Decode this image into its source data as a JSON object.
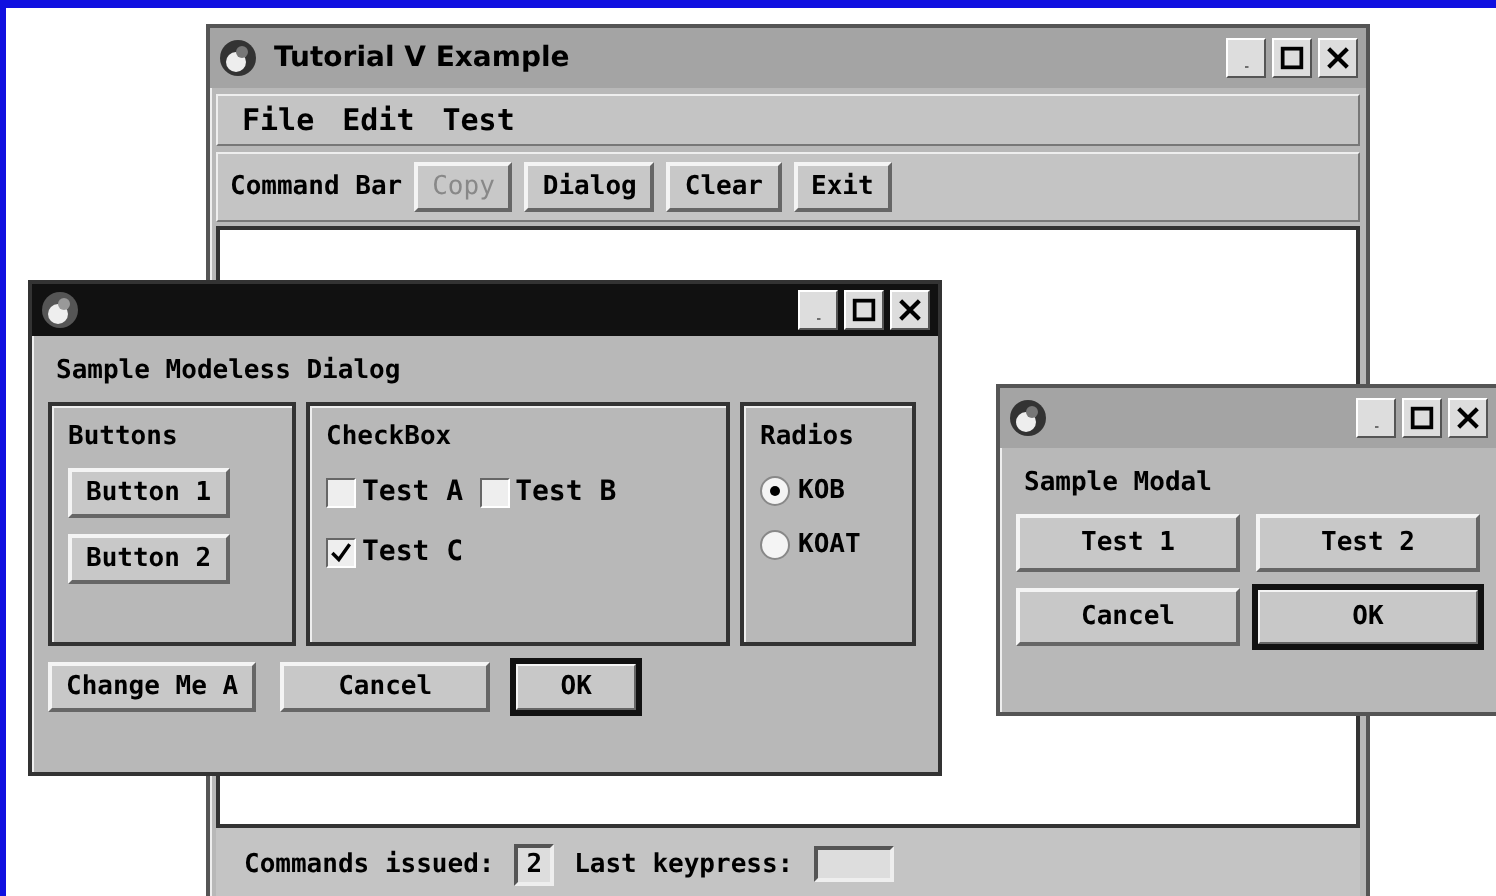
{
  "main_window": {
    "title": "Tutorial V Example",
    "active": false,
    "menu": [
      "File",
      "Edit",
      "Test"
    ],
    "command_bar": {
      "label": "Command Bar",
      "buttons": [
        {
          "label": "Copy",
          "disabled": true
        },
        {
          "label": "Dialog",
          "disabled": false
        },
        {
          "label": "Clear",
          "disabled": false
        },
        {
          "label": "Exit",
          "disabled": false
        }
      ]
    },
    "status_bar": {
      "commands_label": "Commands issued:",
      "commands_value": "2",
      "keypress_label": "Last keypress:"
    }
  },
  "modeless_dialog": {
    "active": true,
    "heading": "Sample Modeless Dialog",
    "buttons_group": {
      "title": "Buttons",
      "buttons": [
        "Button 1",
        "Button 2"
      ]
    },
    "checkbox_group": {
      "title": "CheckBox",
      "items": [
        {
          "label": "Test A",
          "checked": false
        },
        {
          "label": "Test B",
          "checked": false
        },
        {
          "label": "Test C",
          "checked": true
        }
      ]
    },
    "radio_group": {
      "title": "Radios",
      "items": [
        {
          "label": "KOB",
          "selected": true
        },
        {
          "label": "KOAT",
          "selected": false
        }
      ]
    },
    "actions": [
      {
        "label": "Change Me A",
        "default": false
      },
      {
        "label": "Cancel",
        "default": false
      },
      {
        "label": "OK",
        "default": true
      }
    ]
  },
  "modal_dialog": {
    "active": false,
    "heading": "Sample Modal",
    "buttons": [
      {
        "label": "Test 1",
        "default": false
      },
      {
        "label": "Test 2",
        "default": false
      },
      {
        "label": "Cancel",
        "default": false
      },
      {
        "label": "OK",
        "default": true
      }
    ]
  }
}
